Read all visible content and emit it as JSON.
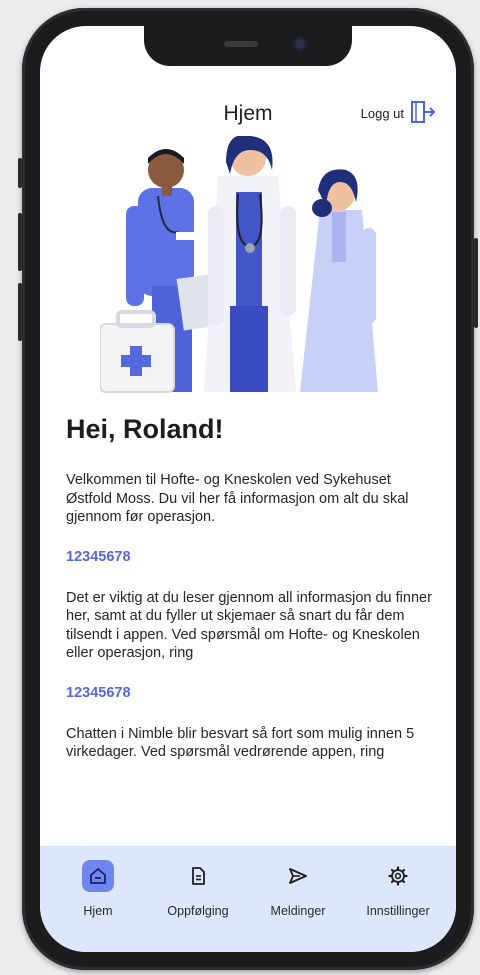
{
  "header": {
    "title": "Hjem",
    "logout_label": "Logg ut"
  },
  "main": {
    "greeting": "Hei, Roland!",
    "intro": "Velkommen til Hofte- og Kneskolen ved Sykehuset Østfold Moss. Du vil her få informasjon om alt du skal gjennom før operasjon.",
    "phone_1": "12345678",
    "info": "Det er viktig at du leser gjennom all informasjon du finner her, samt at du fyller ut skjemaer så snart du får dem tilsendt i appen. Ved spørsmål om Hofte- og Kneskolen eller operasjon, ring",
    "phone_2": "12345678",
    "chat_info": "Chatten i Nimble blir besvart så fort som mulig innen 5 virkedager. Ved spørsmål vedrørende appen, ring"
  },
  "tabs": [
    {
      "label": "Hjem",
      "icon": "home-icon",
      "active": true
    },
    {
      "label": "Oppfølging",
      "icon": "document-icon",
      "active": false
    },
    {
      "label": "Meldinger",
      "icon": "send-icon",
      "active": false
    },
    {
      "label": "Innstillinger",
      "icon": "gear-icon",
      "active": false
    }
  ],
  "colors": {
    "accent": "#5468e0",
    "tabbar_bg": "#dde6fb",
    "active_tab": "#6f86ee"
  }
}
